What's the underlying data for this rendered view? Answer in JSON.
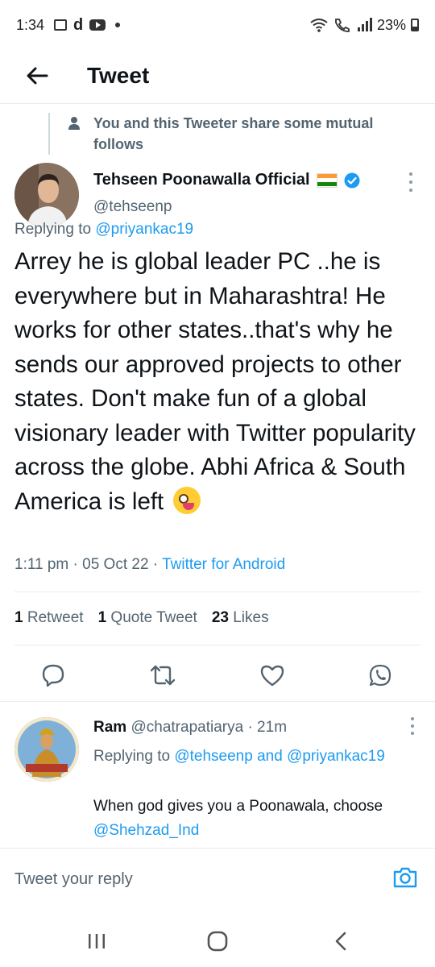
{
  "status_bar": {
    "time": "1:34",
    "battery": "23%"
  },
  "header": {
    "title": "Tweet"
  },
  "mutual_notice": {
    "text": "You and this Tweeter share some mutual follows"
  },
  "tweet": {
    "author_name": "Tehseen Poonawalla Official",
    "author_handle": "@tehseenp",
    "replying_prefix": "Replying to ",
    "replying_to": "@priyankac19",
    "text": "Arrey he is global leader PC ..he is everywhere but in Maharashtra! He works for other states..that's why he sends our approved projects to other states. Don't make fun of a global visionary leader with Twitter popularity across the globe. Abhi Africa & South America is left",
    "time": "1:11 pm · 05 Oct 22 · ",
    "source": "Twitter for Android",
    "stats": {
      "retweets_count": "1",
      "retweets_label": "Retweet",
      "quotes_count": "1",
      "quotes_label": "Quote Tweet",
      "likes_count": "23",
      "likes_label": "Likes"
    }
  },
  "reply": {
    "author_name": "Ram",
    "author_handle": "@chatrapatiarya",
    "time": " · 21m",
    "replying_prefix": "Replying to ",
    "replying_to_1": "@tehseenp",
    "replying_and": " and ",
    "replying_to_2": "@priyankac19",
    "text_prefix": "When god gives you a Poonawala, choose ",
    "text_mention": "@Shehzad_Ind"
  },
  "reply_bar": {
    "placeholder": "Tweet your reply"
  },
  "colors": {
    "accent": "#1d9bf0",
    "secondary_text": "#536471",
    "primary_text": "#0f1419"
  },
  "icons": {
    "back": "arrow-left-icon",
    "person": "person-icon",
    "verified": "verified-badge-icon",
    "reply": "reply-icon",
    "retweet": "retweet-icon",
    "like": "heart-icon",
    "share": "whatsapp-icon",
    "camera": "camera-icon"
  }
}
